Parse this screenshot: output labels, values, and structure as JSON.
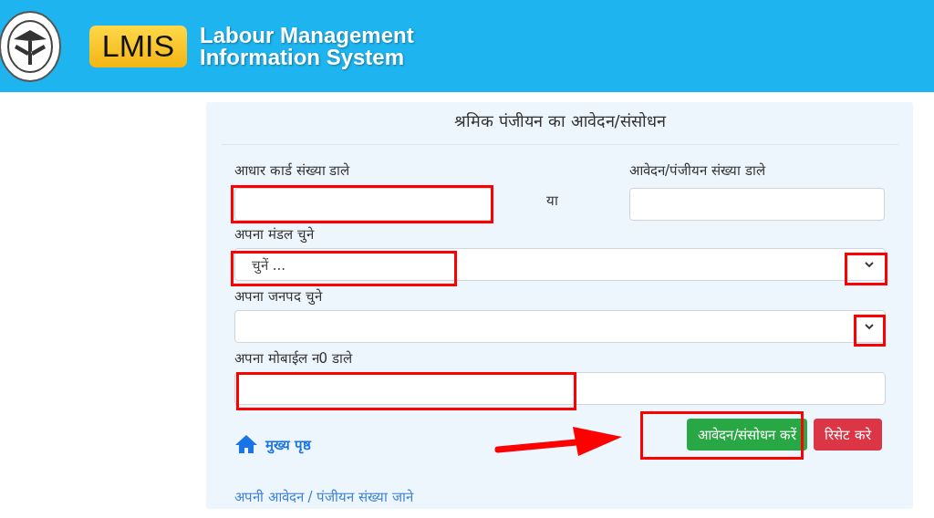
{
  "header": {
    "logo_text": "LMIS",
    "title_lines": [
      "Labour Management",
      "Information System"
    ]
  },
  "form": {
    "title": "श्रमिक पंजीयन का आवेदन/संसोधन",
    "aadhaar": {
      "label": "आधार कार्ड संख्या डाले"
    },
    "or_text": "या",
    "application": {
      "label": "आवेदन/पंजीयन संख्या डाले"
    },
    "division": {
      "label": "अपना मंडल चुने",
      "value": "चुनें ..."
    },
    "district": {
      "label": "अपना जनपद चुने"
    },
    "mobile": {
      "label": "अपना मोबाईल न0 डाले"
    },
    "home_link": "मुख्य पृष्ठ",
    "buttons": [
      {
        "label": "आवेदन/संसोधन करें",
        "kind": "submit"
      },
      {
        "label": "रिसेट करे",
        "kind": "reset"
      }
    ],
    "footer_link": "अपनी आवेदन / पंजीयन संख्या जाने"
  }
}
